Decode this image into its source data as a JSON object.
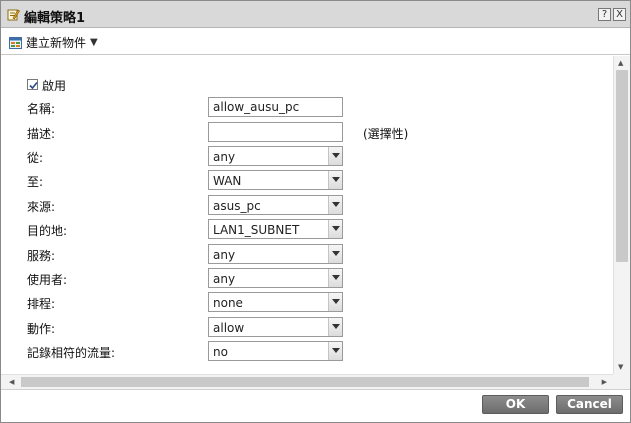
{
  "window": {
    "title": "編輯策略1",
    "help_label": "?",
    "close_label": "X",
    "title_icon": "edit-icon"
  },
  "toolbar": {
    "create_label": "建立新物件",
    "create_icon": "new-object-icon",
    "caret": "▼"
  },
  "form": {
    "enable_label": "啟用",
    "enable_checked": true,
    "name_label": "名稱:",
    "name_value": "allow_ausu_pc",
    "description_label": "描述:",
    "description_value": "",
    "description_hint": "(選擇性)",
    "from_label": "從:",
    "from_value": "any",
    "to_label": "至:",
    "to_value": "WAN",
    "source_label": "來源:",
    "source_value": "asus_pc",
    "destination_label": "目的地:",
    "destination_value": "LAN1_SUBNET",
    "service_label": "服務:",
    "service_value": "any",
    "user_label": "使用者:",
    "user_value": "any",
    "schedule_label": "排程:",
    "schedule_value": "none",
    "action_label": "動作:",
    "action_value": "allow",
    "log_label": "記錄相符的流量:",
    "log_value": "no"
  },
  "scrollbars": {
    "up": "▲",
    "down": "▼",
    "left": "◀",
    "right": "▶"
  },
  "footer": {
    "ok_label": "OK",
    "cancel_label": "Cancel"
  },
  "colors": {
    "titlebar": "#d9d9d9",
    "button": "#7a7a7a",
    "border": "#9a9a9a"
  }
}
